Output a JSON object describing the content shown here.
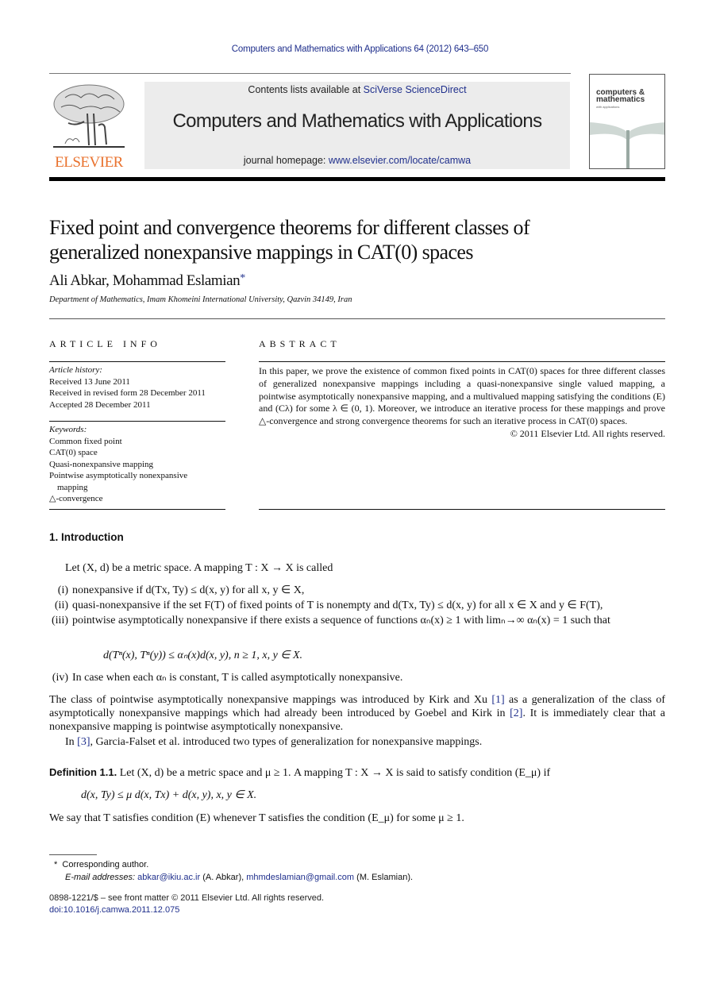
{
  "running_head": "Computers and Mathematics with Applications 64 (2012) 643–650",
  "masthead": {
    "publisher_logo_text": "ELSEVIER",
    "contents_prefix": "Contents lists available at ",
    "contents_link": "SciVerse ScienceDirect",
    "journal_name": "Computers and Mathematics with Applications",
    "homepage_prefix": "journal homepage: ",
    "homepage_link": "www.elsevier.com/locate/camwa",
    "cover_title_1": "computers &",
    "cover_title_2": "mathematics",
    "cover_subtitle": "with applications",
    "colors": {
      "link": "#1f2f8c",
      "elsevier_orange": "#e9722e",
      "banner_bg": "#ececec"
    }
  },
  "article": {
    "title": "Fixed point and convergence theorems for different classes of generalized nonexpansive mappings in CAT(0) spaces",
    "authors": "Ali Abkar, Mohammad Eslamian",
    "corresponding_mark": "*",
    "affiliation": "Department of Mathematics, Imam Khomeini International University, Qazvin 34149, Iran"
  },
  "article_info": {
    "label": "ARTICLE INFO",
    "history_heading": "Article history:",
    "history": [
      "Received 13 June 2011",
      "Received in revised form 28 December 2011",
      "Accepted 28 December 2011"
    ],
    "keywords_heading": "Keywords:",
    "keywords": [
      "Common fixed point",
      "CAT(0) space",
      "Quasi-nonexpansive mapping",
      "Pointwise asymptotically nonexpansive",
      "mapping",
      "△-convergence"
    ]
  },
  "abstract": {
    "label": "ABSTRACT",
    "text": "In this paper, we prove the existence of common fixed points in CAT(0) spaces for three different classes of generalized nonexpansive mappings including a quasi-nonexpansive single valued mapping, a pointwise asymptotically nonexpansive mapping, and a multivalued mapping satisfying the conditions (E) and (Cλ) for some λ ∈ (0, 1). Moreover, we introduce an iterative process for these mappings and prove △-convergence and strong convergence theorems for such an iterative process in CAT(0) spaces.",
    "copyright": "© 2011 Elsevier Ltd. All rights reserved."
  },
  "body": {
    "section_heading": "1.  Introduction",
    "lead": "Let (X, d) be a metric space. A mapping T : X → X is called",
    "items": [
      {
        "num": "(i)",
        "text": "nonexpansive if d(Tx, Ty) ≤ d(x, y) for all x, y ∈ X,"
      },
      {
        "num": "(ii)",
        "text": "quasi-nonexpansive if the set F(T) of fixed points of T is nonempty and d(Tx, Ty) ≤ d(x, y) for all x ∈ X and y ∈ F(T),"
      },
      {
        "num": "(iii)",
        "text": "pointwise asymptotically nonexpansive if there exists a sequence of functions αₙ(x) ≥ 1 with limₙ→∞ αₙ(x) = 1 such that"
      },
      {
        "num": "(iv)",
        "text": "In case when each αₙ is constant, T is called asymptotically nonexpansive."
      }
    ],
    "equation_1": "d(Tⁿ(x), Tⁿ(y)) ≤ αₙ(x)d(x, y),     n ≥ 1,  x, y ∈ X.",
    "para_1_a": "The class of pointwise asymptotically nonexpansive mappings was introduced by Kirk and Xu ",
    "ref_1": "[1]",
    "para_1_b": " as a generalization of the class of asymptotically nonexpansive mappings which had already been introduced by Goebel and Kirk in ",
    "ref_2": "[2]",
    "para_1_c": ". It is immediately clear that a nonexpansive mapping is pointwise asymptotically nonexpansive.",
    "para_2_a": "In ",
    "ref_3": "[3]",
    "para_2_b": ", Garcia-Falset et al. introduced two types of generalization for nonexpansive mappings.",
    "definition_label": "Definition 1.1.",
    "definition_text": " Let (X, d) be a metric space and μ ≥ 1. A mapping T : X → X is said to satisfy condition (E_μ) if",
    "equation_2": "d(x, Ty) ≤ μ d(x, Tx) + d(x, y),     x, y ∈ X.",
    "para_3": "We say that T satisfies condition (E) whenever T satisfies the condition (E_μ) for some μ ≥ 1."
  },
  "footnotes": {
    "star": "*",
    "corresponding": "Corresponding author.",
    "email_heading": "E-mail addresses:",
    "email_1": "abkar@ikiu.ac.ir",
    "email_1_owner": " (A. Abkar), ",
    "email_2": "mhmdeslamian@gmail.com",
    "email_2_owner": " (M. Eslamian).",
    "issn_line": "0898-1221/$ – see front matter © 2011 Elsevier Ltd. All rights reserved.",
    "doi": "doi:10.1016/j.camwa.2011.12.075"
  }
}
